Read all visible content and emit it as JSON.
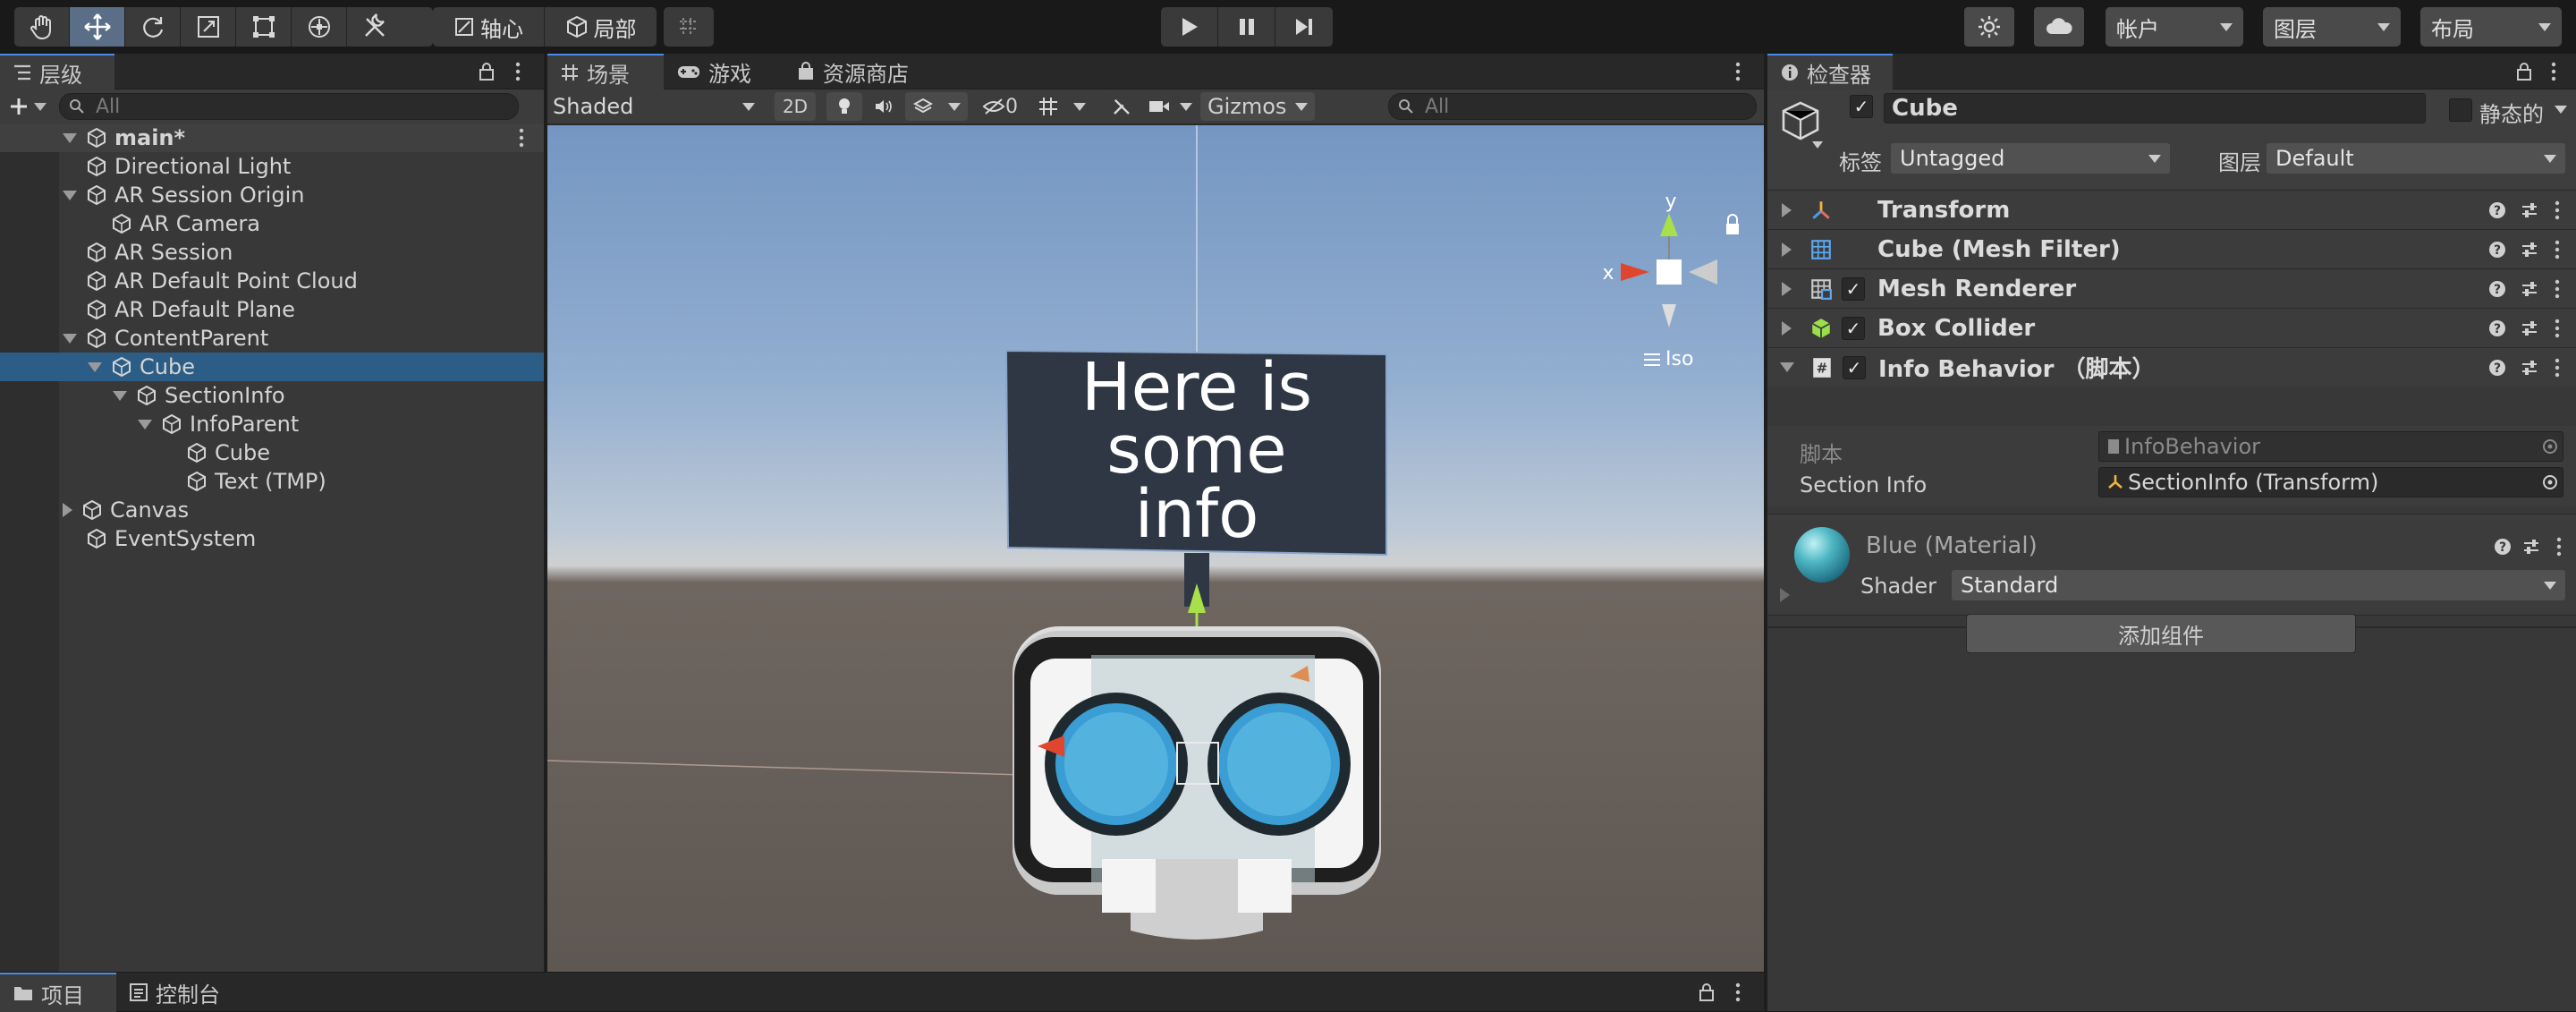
{
  "toolbar": {
    "pivot_label": "轴心",
    "local_label": "局部",
    "account_label": "帐户",
    "layers_label": "图层",
    "layout_label": "布局"
  },
  "hierarchy": {
    "tab_label": "层级",
    "search_placeholder": "All",
    "scene_name": "main*",
    "items": [
      {
        "label": "Directional Light",
        "depth": 1,
        "fold": "none",
        "selected": false
      },
      {
        "label": "AR Session Origin",
        "depth": 1,
        "fold": "down",
        "selected": false
      },
      {
        "label": "AR Camera",
        "depth": 2,
        "fold": "none",
        "selected": false
      },
      {
        "label": "AR Session",
        "depth": 1,
        "fold": "none",
        "selected": false
      },
      {
        "label": "AR Default Point Cloud",
        "depth": 1,
        "fold": "none",
        "selected": false
      },
      {
        "label": "AR Default Plane",
        "depth": 1,
        "fold": "none",
        "selected": false
      },
      {
        "label": "ContentParent",
        "depth": 1,
        "fold": "down",
        "selected": false
      },
      {
        "label": "Cube",
        "depth": 2,
        "fold": "down",
        "selected": true
      },
      {
        "label": "SectionInfo",
        "depth": 3,
        "fold": "down",
        "selected": false
      },
      {
        "label": "InfoParent",
        "depth": 4,
        "fold": "down",
        "selected": false
      },
      {
        "label": "Cube",
        "depth": 5,
        "fold": "none",
        "selected": false
      },
      {
        "label": "Text (TMP)",
        "depth": 5,
        "fold": "none",
        "selected": false
      },
      {
        "label": "Canvas",
        "depth": 1,
        "fold": "right",
        "selected": false
      },
      {
        "label": "EventSystem",
        "depth": 1,
        "fold": "none",
        "selected": false
      }
    ]
  },
  "scene": {
    "tabs": [
      "场景",
      "游戏",
      "资源商店"
    ],
    "shading_mode": "Shaded",
    "mode_2d": "2D",
    "hidden_count": "0",
    "gizmos_label": "Gizmos",
    "search_placeholder": "All",
    "info_text_lines": [
      "Here is",
      "some",
      "info"
    ],
    "gizmo_y": "y",
    "gizmo_x": "x",
    "projection": "Iso"
  },
  "inspector": {
    "tab_label": "检查器",
    "object_name": "Cube",
    "static_label": "静态的",
    "tag_label": "标签",
    "tag_value": "Untagged",
    "layer_label": "图层",
    "layer_value": "Default",
    "components": [
      {
        "label": "Transform",
        "icon": "transform-icon",
        "checkbox": false,
        "expanded": false
      },
      {
        "label": "Cube (Mesh Filter)",
        "icon": "mesh-filter-icon",
        "checkbox": false,
        "expanded": false
      },
      {
        "label": "Mesh Renderer",
        "icon": "mesh-renderer-icon",
        "checkbox": true,
        "expanded": false
      },
      {
        "label": "Box Collider",
        "icon": "box-collider-icon",
        "checkbox": true,
        "expanded": false
      },
      {
        "label": "Info Behavior （脚本）",
        "icon": "script-icon",
        "checkbox": true,
        "expanded": true
      }
    ],
    "script_field_label": "脚本",
    "script_field_value": "InfoBehavior",
    "section_info_label": "Section Info",
    "section_info_value": "SectionInfo (Transform)",
    "material_name": "Blue (Material)",
    "shader_label": "Shader",
    "shader_value": "Standard",
    "add_component_label": "添加组件"
  },
  "bottom": {
    "project_tab": "项目",
    "console_tab": "控制台"
  },
  "colors": {
    "accent": "#2c5d87",
    "tab_underline": "#4a8ae8",
    "sky": "#7e9dc6",
    "ground": "#5f5853",
    "info_panel": "#2f3744",
    "goggle_blue": "#3a9ed4"
  }
}
